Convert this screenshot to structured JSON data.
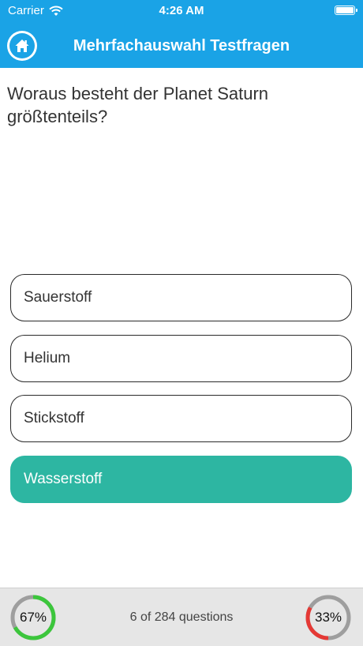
{
  "status_bar": {
    "carrier": "Carrier",
    "time": "4:26 AM"
  },
  "nav": {
    "title": "Mehrfachauswahl Testfragen"
  },
  "question": {
    "text": "Woraus besteht der Planet Saturn größtenteils?"
  },
  "answers": [
    {
      "label": "Sauerstoff",
      "state": "default"
    },
    {
      "label": "Helium",
      "state": "default"
    },
    {
      "label": "Stickstoff",
      "state": "default"
    },
    {
      "label": "Wasserstoff",
      "state": "correct"
    }
  ],
  "footer": {
    "progress_text": "6 of 284 questions",
    "correct_percent_label": "67%",
    "correct_fraction": 0.67,
    "wrong_percent_label": "33%",
    "wrong_fraction": 0.33
  },
  "colors": {
    "accent": "#1aa3e6",
    "correct": "#2db6a2",
    "ring_correct": "#3cc63c",
    "ring_wrong": "#e53935",
    "ring_track": "#9e9e9e"
  }
}
